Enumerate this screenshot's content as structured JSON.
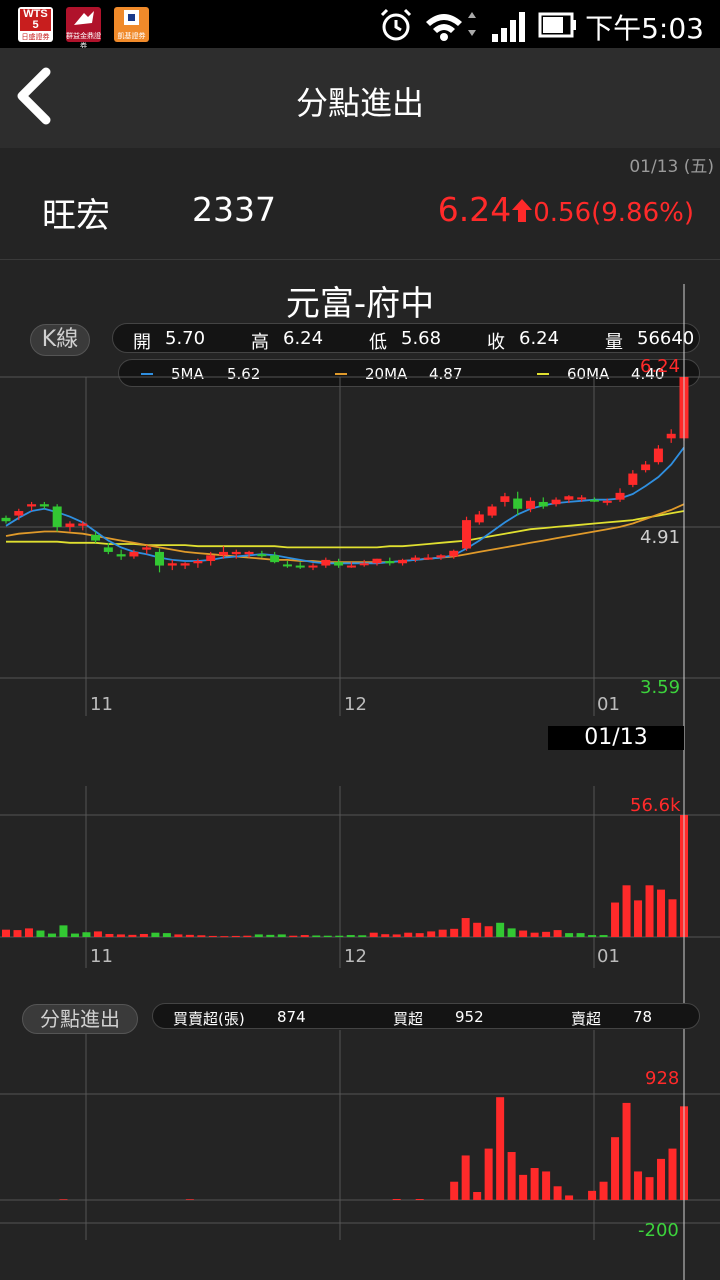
{
  "statusbar": {
    "apps": [
      {
        "name": "WTS 5",
        "sub": "日盛證券",
        "bg": "#c81e1e"
      },
      {
        "name": "CAPITAL",
        "sub": "群益金鼎證券",
        "bg": "#b0122b"
      },
      {
        "name": "凱基",
        "sub": "凱基證券",
        "bg": "#e87a1e"
      }
    ],
    "time": "下午5:03"
  },
  "header": {
    "title": "分點進出"
  },
  "stock": {
    "date": "01/13 (五)",
    "name": "旺宏",
    "code": "2337",
    "price": "6.24",
    "change": "0.56(9.86%)",
    "up_color": "#ff2a2a"
  },
  "broker": {
    "title": "元富-府中"
  },
  "kline": {
    "button_label": "K線",
    "ohlc": {
      "open_label": "開",
      "open": "5.70",
      "high_label": "高",
      "high": "6.24",
      "low_label": "低",
      "low": "5.68",
      "close_label": "收",
      "close": "6.24",
      "vol_label": "量",
      "vol": "56640"
    },
    "ma": {
      "ma5_label": "5MA",
      "ma5": "5.62",
      "ma5_color": "#2f8fe0",
      "ma20_label": "20MA",
      "ma20": "4.87",
      "ma20_color": "#e09a2a",
      "ma60_label": "60MA",
      "ma60": "4.40",
      "ma60_color": "#e0e030"
    }
  },
  "price_axis": {
    "top": "6.24",
    "mid": "4.91",
    "bottom": "3.59"
  },
  "month_labels": [
    "11",
    "12",
    "01"
  ],
  "cursor_date": "01/13",
  "volume_axis": {
    "top": "56.6k"
  },
  "netbuy": {
    "button_label": "分點進出",
    "summary_label": "買賣超(張)",
    "summary": "874",
    "buy_label": "買超",
    "buy": "952",
    "sell_label": "賣超",
    "sell": "78"
  },
  "netbuy_axis": {
    "top": "928",
    "bottom": "-200"
  },
  "chart_data": [
    {
      "type": "candlestick",
      "title": "",
      "ylim": [
        3.59,
        6.24
      ],
      "candles": [
        [
          5.0,
          5.02,
          4.95,
          4.97
        ],
        [
          5.02,
          5.08,
          4.98,
          5.06
        ],
        [
          5.1,
          5.14,
          5.06,
          5.12
        ],
        [
          5.12,
          5.14,
          5.08,
          5.1
        ],
        [
          5.1,
          5.12,
          4.88,
          4.92
        ],
        [
          4.92,
          4.97,
          4.88,
          4.95
        ],
        [
          4.93,
          4.97,
          4.89,
          4.95
        ],
        [
          4.85,
          4.88,
          4.78,
          4.8
        ],
        [
          4.74,
          4.78,
          4.68,
          4.7
        ],
        [
          4.68,
          4.72,
          4.63,
          4.66
        ],
        [
          4.66,
          4.72,
          4.64,
          4.7
        ],
        [
          4.72,
          4.76,
          4.68,
          4.74
        ],
        [
          4.7,
          4.73,
          4.52,
          4.58
        ],
        [
          4.58,
          4.63,
          4.54,
          4.6
        ],
        [
          4.58,
          4.61,
          4.55,
          4.6
        ],
        [
          4.6,
          4.64,
          4.56,
          4.62
        ],
        [
          4.62,
          4.7,
          4.58,
          4.67
        ],
        [
          4.67,
          4.75,
          4.64,
          4.7
        ],
        [
          4.68,
          4.72,
          4.64,
          4.7
        ],
        [
          4.68,
          4.71,
          4.65,
          4.7
        ],
        [
          4.68,
          4.71,
          4.65,
          4.67
        ],
        [
          4.67,
          4.7,
          4.6,
          4.61
        ],
        [
          4.59,
          4.62,
          4.56,
          4.58
        ],
        [
          4.58,
          4.61,
          4.55,
          4.57
        ],
        [
          4.57,
          4.6,
          4.54,
          4.58
        ],
        [
          4.58,
          4.65,
          4.56,
          4.63
        ],
        [
          4.61,
          4.64,
          4.56,
          4.58
        ],
        [
          4.58,
          4.61,
          4.56,
          4.58
        ],
        [
          4.6,
          4.63,
          4.57,
          4.6
        ],
        [
          4.6,
          4.64,
          4.58,
          4.64
        ],
        [
          4.62,
          4.65,
          4.58,
          4.6
        ],
        [
          4.6,
          4.64,
          4.58,
          4.63
        ],
        [
          4.63,
          4.67,
          4.61,
          4.65
        ],
        [
          4.65,
          4.68,
          4.63,
          4.65
        ],
        [
          4.65,
          4.68,
          4.63,
          4.67
        ],
        [
          4.66,
          4.72,
          4.64,
          4.71
        ],
        [
          4.73,
          5.01,
          4.71,
          4.98
        ],
        [
          4.96,
          5.06,
          4.94,
          5.03
        ],
        [
          5.02,
          5.12,
          5.0,
          5.1
        ],
        [
          5.14,
          5.22,
          5.1,
          5.19
        ],
        [
          5.17,
          5.23,
          5.02,
          5.08
        ],
        [
          5.08,
          5.18,
          5.05,
          5.15
        ],
        [
          5.14,
          5.18,
          5.08,
          5.1
        ],
        [
          5.12,
          5.18,
          5.1,
          5.16
        ],
        [
          5.16,
          5.2,
          5.13,
          5.19
        ],
        [
          5.17,
          5.2,
          5.14,
          5.18
        ],
        [
          5.16,
          5.18,
          5.14,
          5.15
        ],
        [
          5.14,
          5.17,
          5.11,
          5.15
        ],
        [
          5.16,
          5.26,
          5.14,
          5.22
        ],
        [
          5.29,
          5.42,
          5.27,
          5.39
        ],
        [
          5.42,
          5.5,
          5.4,
          5.47
        ],
        [
          5.49,
          5.64,
          5.47,
          5.61
        ],
        [
          5.7,
          5.78,
          5.66,
          5.74
        ],
        [
          5.7,
          6.24,
          5.68,
          6.24
        ]
      ],
      "ma5": [
        4.93,
        5.0,
        5.06,
        5.08,
        5.05,
        5.01,
        4.96,
        4.88,
        4.8,
        4.74,
        4.7,
        4.68,
        4.65,
        4.63,
        4.62,
        4.62,
        4.63,
        4.65,
        4.66,
        4.67,
        4.68,
        4.67,
        4.65,
        4.63,
        4.61,
        4.6,
        4.6,
        4.6,
        4.6,
        4.6,
        4.61,
        4.62,
        4.63,
        4.64,
        4.65,
        4.67,
        4.73,
        4.8,
        4.88,
        4.96,
        5.03,
        5.08,
        5.11,
        5.13,
        5.14,
        5.15,
        5.16,
        5.16,
        5.17,
        5.21,
        5.28,
        5.36,
        5.47,
        5.62
      ],
      "ma20": [
        4.84,
        4.86,
        4.87,
        4.88,
        4.88,
        4.87,
        4.86,
        4.84,
        4.82,
        4.8,
        4.78,
        4.76,
        4.74,
        4.72,
        4.7,
        4.69,
        4.68,
        4.67,
        4.66,
        4.65,
        4.64,
        4.63,
        4.63,
        4.62,
        4.62,
        4.61,
        4.61,
        4.61,
        4.61,
        4.61,
        4.61,
        4.62,
        4.63,
        4.64,
        4.65,
        4.66,
        4.68,
        4.7,
        4.72,
        4.74,
        4.76,
        4.78,
        4.8,
        4.82,
        4.84,
        4.86,
        4.88,
        4.9,
        4.92,
        4.95,
        4.99,
        5.03,
        5.07,
        5.12
      ],
      "ma60": [
        4.79,
        4.79,
        4.79,
        4.79,
        4.79,
        4.78,
        4.78,
        4.78,
        4.77,
        4.77,
        4.77,
        4.76,
        4.76,
        4.76,
        4.76,
        4.75,
        4.75,
        4.75,
        4.75,
        4.75,
        4.75,
        4.75,
        4.74,
        4.74,
        4.74,
        4.74,
        4.74,
        4.74,
        4.74,
        4.74,
        4.75,
        4.75,
        4.76,
        4.77,
        4.78,
        4.79,
        4.8,
        4.82,
        4.84,
        4.86,
        4.88,
        4.9,
        4.91,
        4.92,
        4.93,
        4.94,
        4.95,
        4.96,
        4.97,
        4.98,
        5.0,
        5.02,
        5.04,
        5.06
      ]
    },
    {
      "type": "bar",
      "title": "",
      "ylim": [
        0,
        56640
      ],
      "values": [
        3400,
        3200,
        4000,
        3000,
        1600,
        5400,
        1600,
        2200,
        2600,
        1400,
        1200,
        1000,
        1400,
        2000,
        1800,
        1200,
        1000,
        800,
        500,
        400,
        500,
        600,
        1200,
        1000,
        1200,
        600,
        900,
        700,
        600,
        600,
        900,
        800,
        2000,
        1300,
        1200,
        2000,
        1800,
        2600,
        3400,
        3800,
        8800,
        6600,
        5000,
        6600,
        4000,
        3000,
        2000,
        2400,
        3200,
        1800,
        1800,
        900,
        900,
        16000,
        24000,
        17000,
        24000,
        22000,
        17500,
        56640
      ],
      "colors": [
        "r",
        "r",
        "r",
        "g",
        "g",
        "g",
        "g",
        "g",
        "r",
        "r",
        "r",
        "r",
        "r",
        "g",
        "g",
        "r",
        "r",
        "r",
        "r",
        "r",
        "r",
        "r",
        "g",
        "g",
        "g",
        "r",
        "r",
        "g",
        "g",
        "g",
        "g",
        "g",
        "r",
        "r",
        "r",
        "r",
        "r",
        "r",
        "r",
        "r",
        "r",
        "r",
        "r",
        "g",
        "g",
        "r",
        "r",
        "r",
        "r",
        "g",
        "g",
        "g",
        "g",
        "r",
        "r",
        "r",
        "r",
        "r",
        "r",
        "r"
      ]
    },
    {
      "type": "bar",
      "title": "",
      "ylim": [
        -200,
        928
      ],
      "values": [
        0,
        0,
        0,
        0,
        0,
        3,
        0,
        0,
        0,
        0,
        0,
        0,
        0,
        0,
        0,
        0,
        4,
        0,
        0,
        0,
        0,
        0,
        0,
        0,
        0,
        0,
        0,
        0,
        0,
        0,
        0,
        0,
        0,
        0,
        8,
        0,
        8,
        0,
        0,
        160,
        390,
        70,
        450,
        900,
        420,
        220,
        280,
        250,
        120,
        40,
        0,
        80,
        160,
        550,
        850,
        250,
        200,
        360,
        450,
        820
      ]
    }
  ]
}
